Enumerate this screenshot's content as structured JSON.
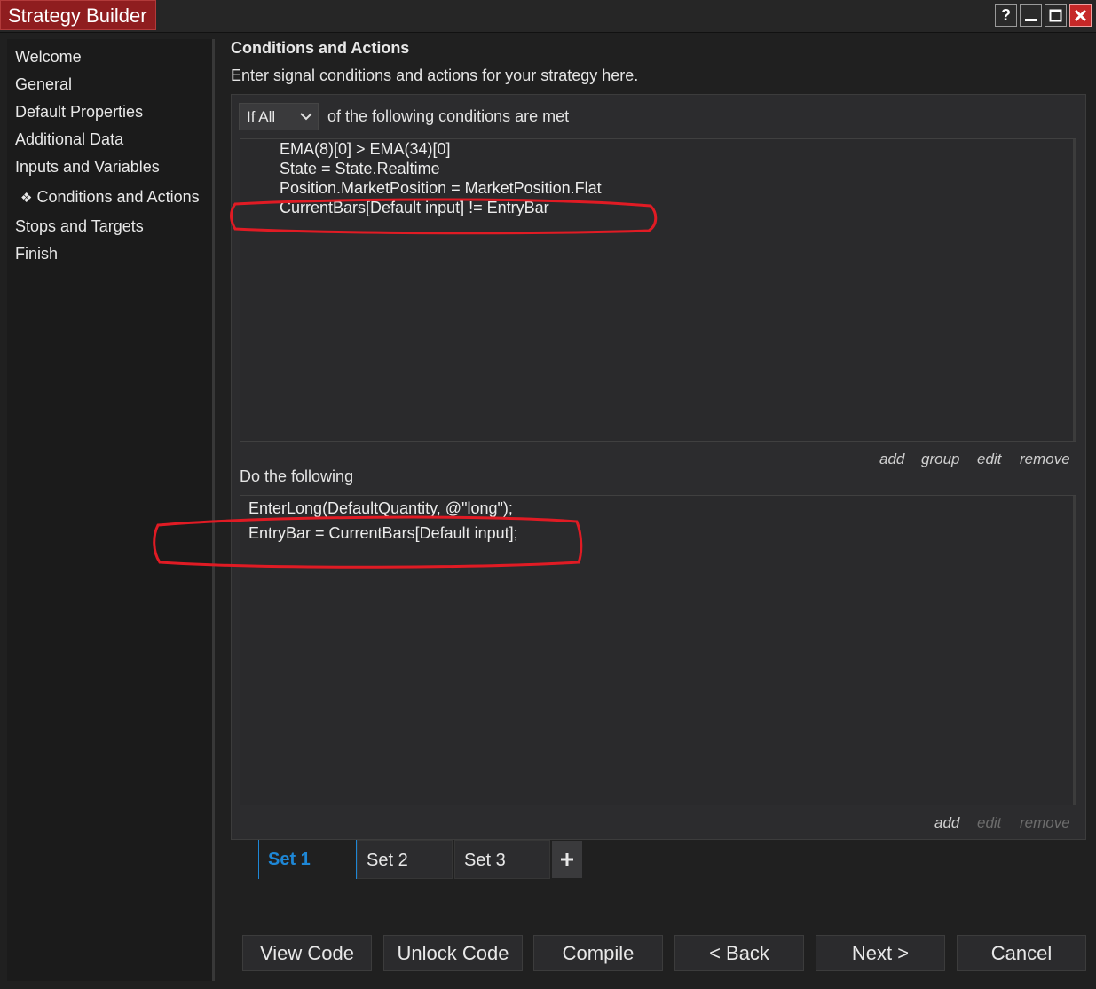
{
  "window": {
    "title": "Strategy Builder",
    "controls": {
      "help": "?"
    }
  },
  "sidebar": {
    "items": [
      {
        "label": "Welcome"
      },
      {
        "label": "General"
      },
      {
        "label": "Default Properties"
      },
      {
        "label": "Additional Data"
      },
      {
        "label": "Inputs and Variables"
      },
      {
        "label": "Conditions and Actions",
        "bullet": "❖"
      },
      {
        "label": "Stops and Targets"
      },
      {
        "label": "Finish"
      }
    ]
  },
  "main": {
    "title": "Conditions and Actions",
    "subtitle": "Enter signal conditions and actions for your strategy here.",
    "match_select": {
      "value": "If All"
    },
    "match_label": "of the following conditions are met",
    "conditions": [
      "EMA(8)[0] > EMA(34)[0]",
      "State = State.Realtime",
      "Position.MarketPosition = MarketPosition.Flat",
      "CurrentBars[Default input] != EntryBar"
    ],
    "condition_actions": {
      "add": "add",
      "group": "group",
      "edit": "edit",
      "remove": "remove"
    },
    "actions_label": "Do the following",
    "actions": [
      "EnterLong(DefaultQuantity, @\"long\");",
      "EntryBar = CurrentBars[Default input];"
    ],
    "action_actions": {
      "add": "add",
      "edit": "edit",
      "remove": "remove"
    }
  },
  "sets": {
    "tabs": [
      {
        "label": "Set 1",
        "active": true
      },
      {
        "label": "Set 2",
        "active": false
      },
      {
        "label": "Set 3",
        "active": false
      }
    ],
    "add_label": "+"
  },
  "buttons": {
    "view_code": "View Code",
    "unlock_code": "Unlock Code",
    "compile": "Compile",
    "back": "< Back",
    "next": "Next >",
    "cancel": "Cancel"
  },
  "colors": {
    "title_tab": "#8f1d1f",
    "accent_blue": "#1e87d6",
    "annotation_red": "#e01b24",
    "close_button": "#c62828"
  }
}
